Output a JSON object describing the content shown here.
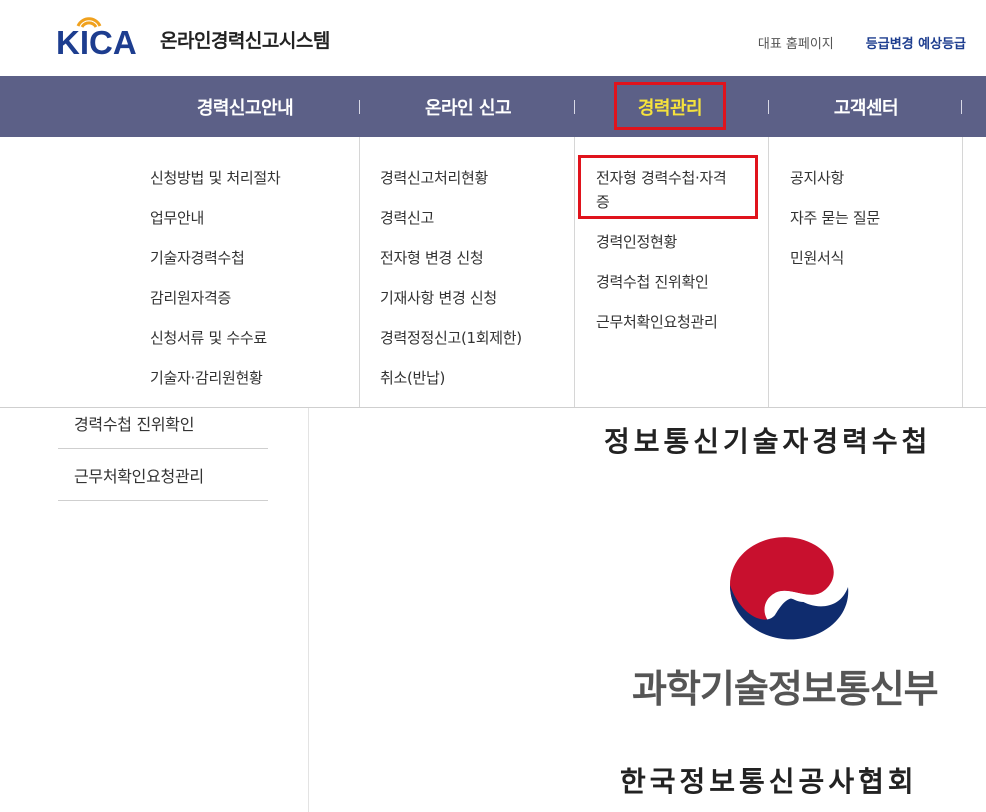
{
  "header": {
    "logo_text": "KICA",
    "site_title": "온라인경력신고시스템",
    "util_links": [
      "대표 홈페이지",
      "등급변경 예상등급"
    ]
  },
  "nav": {
    "items": [
      "경력신고안내",
      "온라인 신고",
      "경력관리",
      "고객센터"
    ],
    "active": "경력관리",
    "active_color": "#f6e23c",
    "bar_color": "#5c6087",
    "highlight_color": "#e0131c"
  },
  "dropdown": {
    "col1": [
      "신청방법 및 처리절차",
      "업무안내",
      "기술자경력수첩",
      "감리원자격증",
      "신청서류 및 수수료",
      "기술자·감리원현황"
    ],
    "col2": [
      "경력신고처리현황",
      "경력신고",
      "전자형 변경 신청",
      "기재사항 변경 신청",
      "경력정정신고(1회제한)",
      "취소(반납)"
    ],
    "col3": [
      "전자형 경력수첩·자격",
      "증",
      "경력인정현황",
      "경력수첩 진위확인",
      "근무처확인요청관리"
    ],
    "col4": [
      "공지사항",
      "자주 묻는 질문",
      "민원서식"
    ]
  },
  "sidebar": {
    "items": [
      "경력수첩 진위확인",
      "근무처확인요청관리"
    ]
  },
  "content": {
    "doc_title": "정보통신기술자경력수첩",
    "ministry": "과학기술정보통신부",
    "association": "한국정보통신공사협회"
  }
}
